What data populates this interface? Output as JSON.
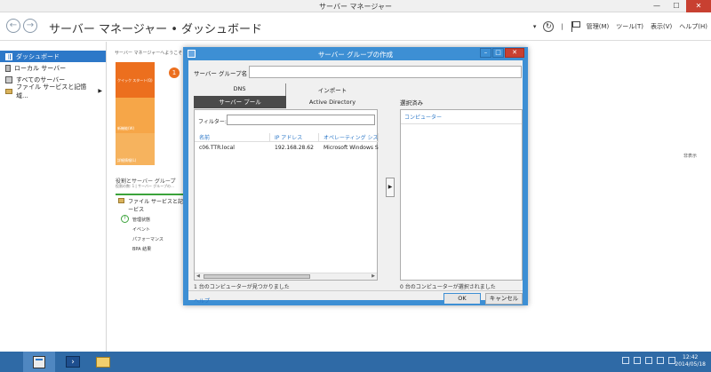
{
  "window": {
    "title": "サーバー マネージャー",
    "buttons": [
      "—",
      "☐",
      "✕"
    ]
  },
  "header": {
    "title": "サーバー マネージャー • ダッシュボード",
    "menus": [
      "管理(M)",
      "ツール(T)",
      "表示(V)",
      "ヘルプ(H)"
    ]
  },
  "sidebar": {
    "items": [
      {
        "label": "ダッシュボード"
      },
      {
        "label": "ローカル サーバー"
      },
      {
        "label": "すべてのサーバー"
      },
      {
        "label": "ファイル サービスと記憶域..."
      }
    ]
  },
  "main": {
    "welcome": "サーバー マネージャーへようこそ",
    "tiles": [
      "クイック スタート(Q)",
      "新機能(W)",
      "詳細情報(L)"
    ],
    "badge": "1",
    "hide": "非表示",
    "roles_title": "役割とサーバー グループ",
    "roles_sub": "役割の数: 1 | サーバー グループの...",
    "rolecard": {
      "title": "ファイル サービスと記憶域サービス",
      "items": [
        "管理状態",
        "イベント",
        "パフォーマンス",
        "BPA 結果"
      ]
    }
  },
  "dialog": {
    "title": "サーバー グループの作成",
    "name_label": "サーバー グループ名",
    "tabs": [
      "DNS",
      "インポート"
    ],
    "subtabs": [
      "サーバー プール",
      "Active Directory"
    ],
    "filter_label": "フィルター:",
    "columns": [
      "名前",
      "IP アドレス",
      "オペレーティング システム"
    ],
    "rows": [
      {
        "name": "c06.TTR.local",
        "ip": "192.168.28.62",
        "os": "Microsoft Windows S"
      }
    ],
    "left_status": "1 台のコンピューターが見つかりました",
    "selected_label": "選択済み",
    "selected_column": "コンピューター",
    "right_status": "0 台のコンピューターが選択されました",
    "help": "ヘルプ",
    "ok": "OK",
    "cancel": "キャンセル",
    "move_glyph": "▶"
  },
  "taskbar": {
    "time": "12:42",
    "date": "2014/05/18"
  }
}
